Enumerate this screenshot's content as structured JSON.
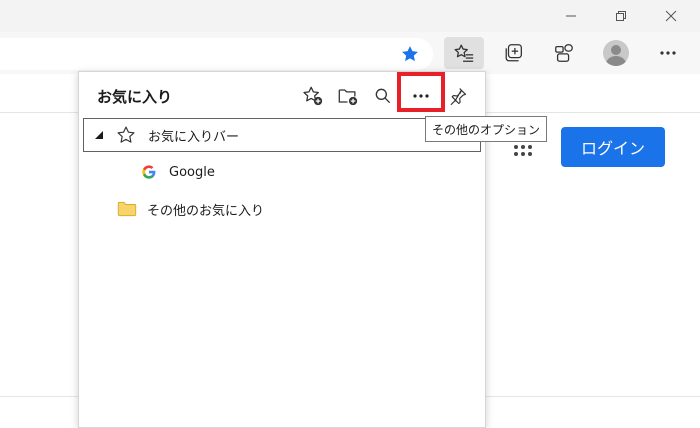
{
  "panel": {
    "title": "お気に入り",
    "tooltip": "その他のオプション",
    "items": [
      {
        "label": "お気に入りバー",
        "icon": "star-outline-icon",
        "expanded": true
      },
      {
        "label": "Google",
        "icon": "google-icon"
      },
      {
        "label": "その他のお気に入り",
        "icon": "folder-icon"
      }
    ]
  },
  "page": {
    "login_label": "ログイン"
  },
  "colors": {
    "accent": "#1a73e8",
    "highlight": "#e8202a",
    "star": "#1a73e8",
    "folder": "#f5c542"
  }
}
